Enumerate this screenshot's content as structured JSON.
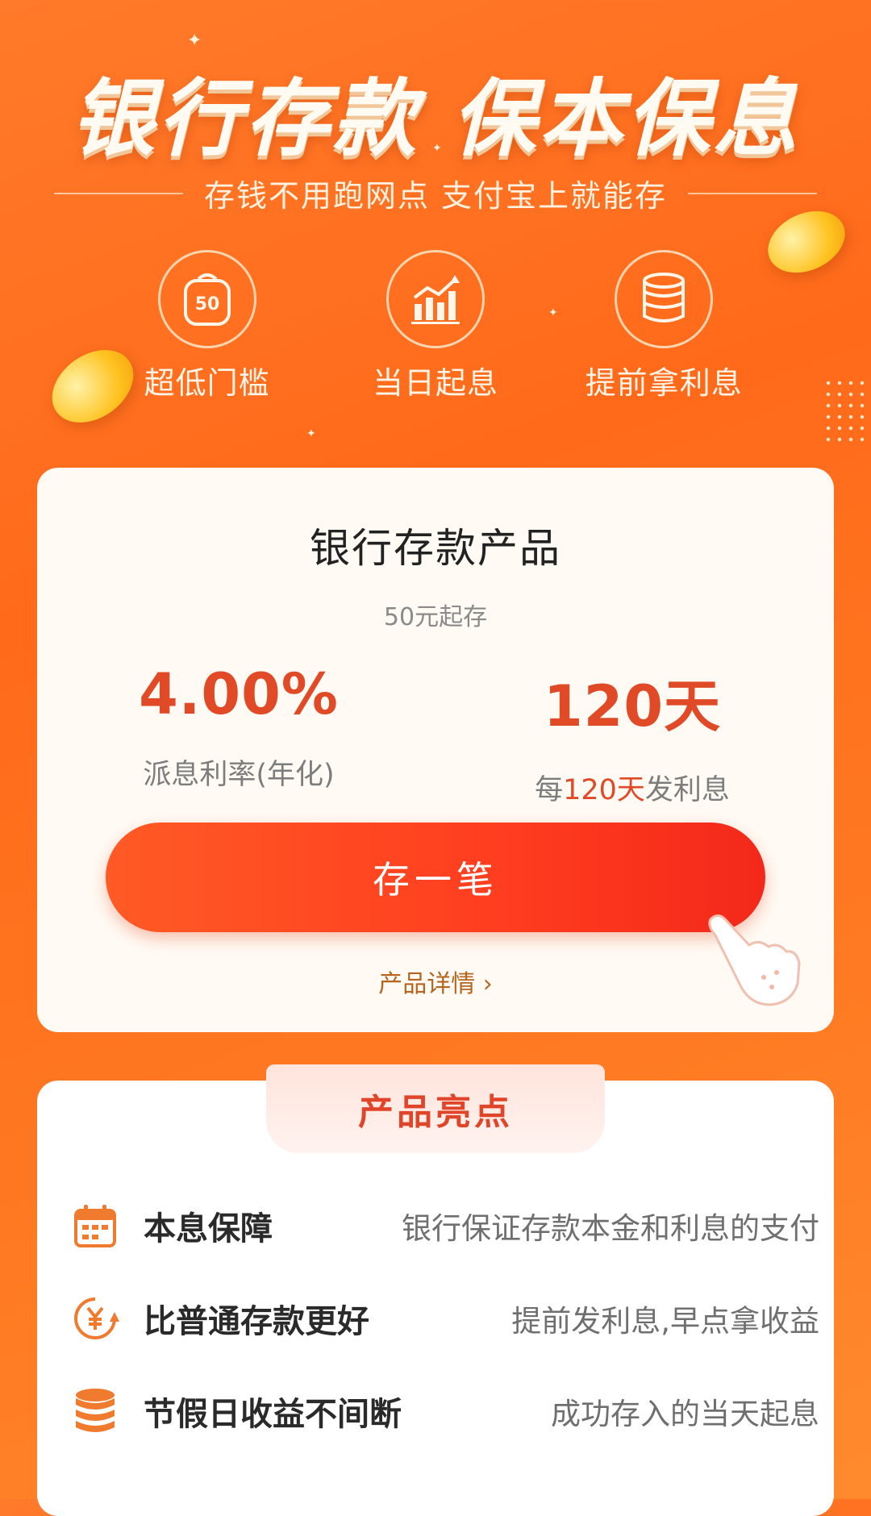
{
  "hero": {
    "headline": "银行存款 保本保息",
    "subline": "存钱不用跑网点 支付宝上就能存",
    "features": [
      {
        "icon": "bag-50-icon",
        "badge": "50",
        "label": "超低门槛"
      },
      {
        "icon": "growth-chart-icon",
        "label": "当日起息"
      },
      {
        "icon": "coin-stack-icon",
        "label": "提前拿利息"
      }
    ]
  },
  "product_card": {
    "title": "银行存款产品",
    "min_deposit": "50元起存",
    "rate_value": "4.00%",
    "rate_label": "派息利率(年化)",
    "period_value": "120天",
    "period_label_prefix": "每",
    "period_label_highlight": "120天",
    "period_label_suffix": "发利息",
    "cta_label": "存一笔",
    "details_link": "产品详情 ›"
  },
  "highlights": {
    "title": "产品亮点",
    "items": [
      {
        "icon": "calendar-icon",
        "name": "本息保障",
        "desc": "银行保证存款本金和利息的支付"
      },
      {
        "icon": "yuan-cycle-icon",
        "name": "比普通存款更好",
        "desc": "提前发利息,早点拿收益"
      },
      {
        "icon": "coin-stack-icon",
        "name": "节假日收益不间断",
        "desc": "成功存入的当天起息"
      }
    ]
  },
  "colors": {
    "background": "#ff6a1a",
    "accent_red": "#e04a26",
    "button_red": "#ff3d1f",
    "link_brown": "#b5651d"
  }
}
